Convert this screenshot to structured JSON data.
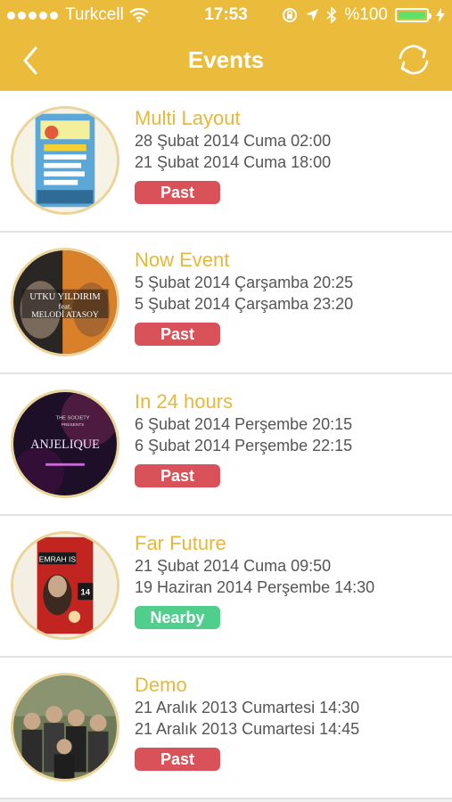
{
  "status_bar": {
    "carrier": "Turkcell",
    "time": "17:53",
    "battery_text": "%100"
  },
  "nav": {
    "title": "Events",
    "back_icon": "chevron-left-icon",
    "refresh_icon": "refresh-icon"
  },
  "colors": {
    "header": "#ebbc3c",
    "title_accent": "#e7b73a",
    "past": "#d9525a",
    "nearby": "#4fce8c"
  },
  "events": [
    {
      "title": "Multi Layout",
      "start": "28 Şubat 2014 Cuma 02:00",
      "end": "21 Şubat 2014 Cuma 18:00",
      "status": "Past"
    },
    {
      "title": "Now Event",
      "start": "5 Şubat 2014 Çarşamba 20:25",
      "end": "5 Şubat 2014 Çarşamba 23:20",
      "status": "Past",
      "poster_text_1": "UTKU YILDIRIM",
      "poster_text_2": "feat.",
      "poster_text_3": "MELODİ ATASOY"
    },
    {
      "title": "In 24 hours",
      "start": "6 Şubat 2014 Perşembe 20:15",
      "end": "6 Şubat 2014 Perşembe 22:15",
      "status": "Past",
      "poster_text_1": "THE SOCIETY",
      "poster_text_2": "PRESENTS",
      "poster_text_3": "ANJELIQUE"
    },
    {
      "title": "Far Future",
      "start": "21 Şubat 2014 Cuma 09:50",
      "end": "19 Haziran 2014 Perşembe 14:30",
      "status": "Nearby",
      "poster_text_1": "EMRAH IS",
      "poster_text_2": "14"
    },
    {
      "title": "Demo",
      "start": "21 Aralık 2013 Cumartesi 14:30",
      "end": "21 Aralık 2013 Cumartesi 14:45",
      "status": "Past"
    }
  ]
}
